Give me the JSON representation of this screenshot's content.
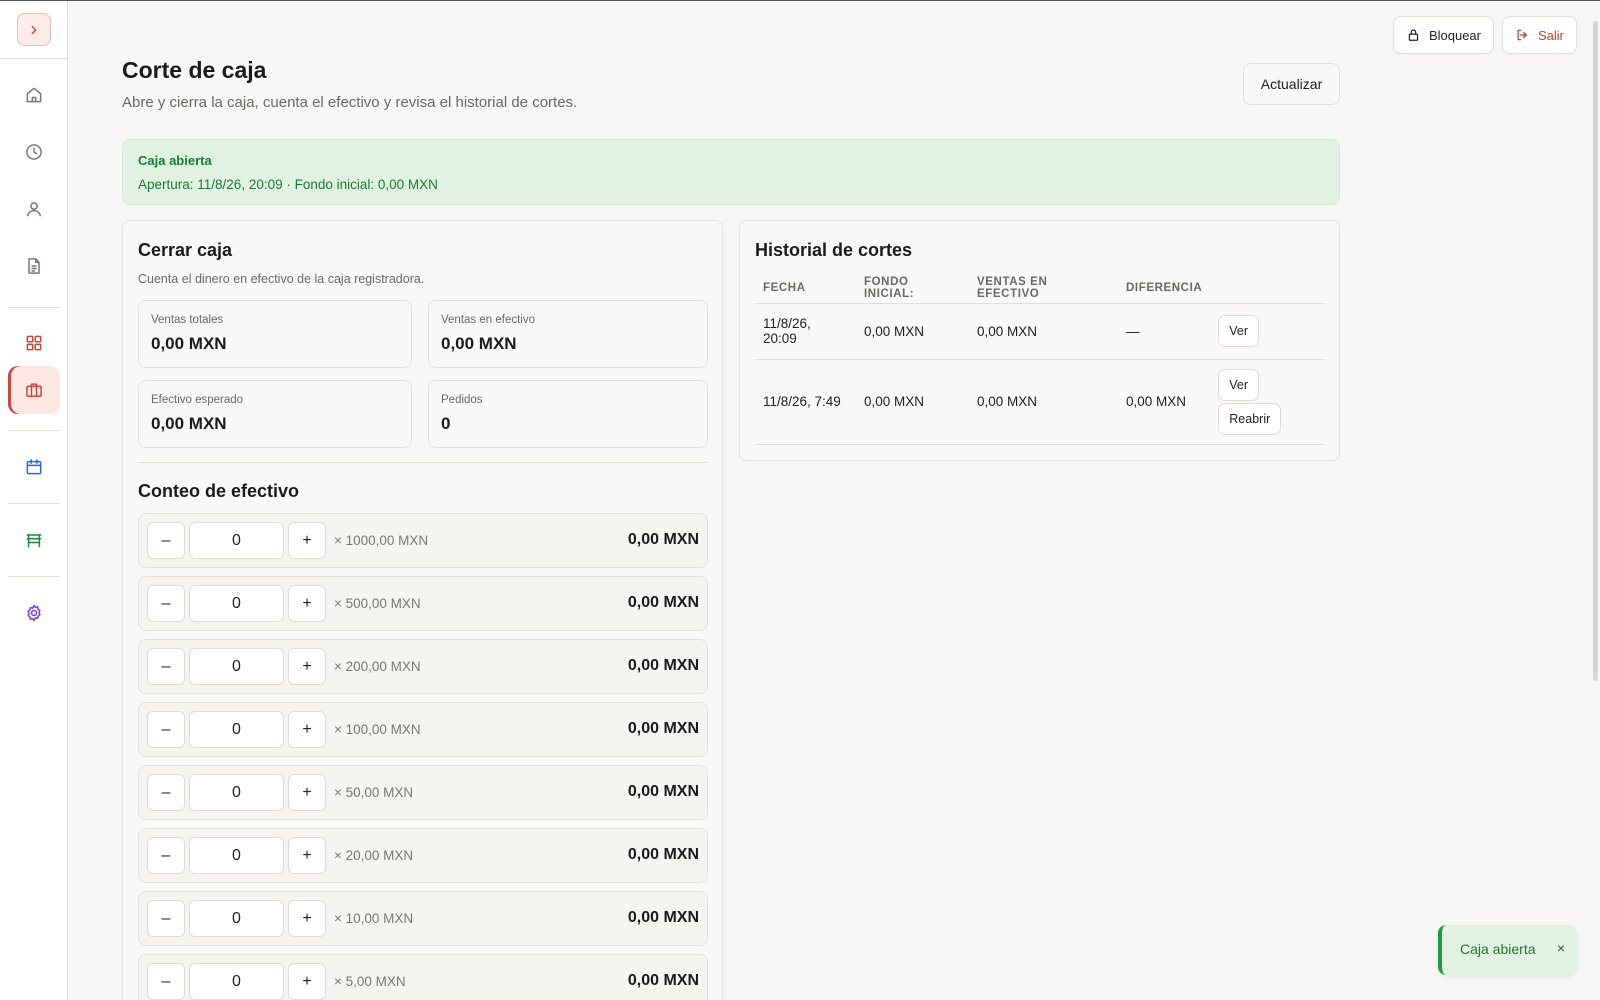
{
  "sidebar": {
    "toggle_icon": "chevron-right-icon",
    "items": [
      {
        "name": "home",
        "icon": "home-icon"
      },
      {
        "name": "history",
        "icon": "clock-icon"
      },
      {
        "name": "user",
        "icon": "user-icon"
      },
      {
        "name": "document",
        "icon": "document-icon"
      },
      {
        "name": "dashboard",
        "icon": "grid-icon"
      },
      {
        "name": "cash-register",
        "icon": "briefcase-icon",
        "active": true
      },
      {
        "name": "calendar",
        "icon": "calendar-icon"
      },
      {
        "name": "tables",
        "icon": "table-icon"
      },
      {
        "name": "settings",
        "icon": "gear-icon"
      }
    ],
    "colors": {
      "accent": "#c9463a",
      "green": "#1f8a3b",
      "blue": "#2563eb",
      "purple": "#7c3aed"
    }
  },
  "topbar": {
    "lock_label": "Bloquear",
    "exit_label": "Salir"
  },
  "header": {
    "title": "Corte de caja",
    "subtitle": "Abre y cierra la caja, cuenta el efectivo y revisa el historial de cortes.",
    "refresh_label": "Actualizar"
  },
  "banner": {
    "title": "Caja abierta",
    "detail": "Apertura: 11/8/26, 20:09 · Fondo inicial: 0,00 MXN"
  },
  "close_panel": {
    "title": "Cerrar caja",
    "description": "Cuenta el dinero en efectivo de la caja registradora.",
    "stats": [
      {
        "label": "Ventas totales",
        "value": "0,00 MXN"
      },
      {
        "label": "Ventas en efectivo",
        "value": "0,00 MXN"
      },
      {
        "label": "Efectivo esperado",
        "value": "0,00 MXN"
      },
      {
        "label": "Pedidos",
        "value": "0"
      }
    ],
    "count_title": "Conteo de efectivo",
    "minus_label": "–",
    "plus_label": "+",
    "denominations": [
      {
        "label": "× 1000,00 MXN",
        "qty": "0",
        "total": "0,00 MXN"
      },
      {
        "label": "× 500,00 MXN",
        "qty": "0",
        "total": "0,00 MXN"
      },
      {
        "label": "× 200,00 MXN",
        "qty": "0",
        "total": "0,00 MXN"
      },
      {
        "label": "× 100,00 MXN",
        "qty": "0",
        "total": "0,00 MXN"
      },
      {
        "label": "× 50,00 MXN",
        "qty": "0",
        "total": "0,00 MXN"
      },
      {
        "label": "× 20,00 MXN",
        "qty": "0",
        "total": "0,00 MXN"
      },
      {
        "label": "× 10,00 MXN",
        "qty": "0",
        "total": "0,00 MXN"
      },
      {
        "label": "× 5,00 MXN",
        "qty": "0",
        "total": "0,00 MXN"
      }
    ]
  },
  "history": {
    "title": "Historial de cortes",
    "columns": [
      "FECHA",
      "FONDO INICIAL:",
      "VENTAS EN EFECTIVO",
      "DIFERENCIA"
    ],
    "rows": [
      {
        "fecha": "11/8/26, 20:09",
        "fondo": "0,00 MXN",
        "ventas": "0,00 MXN",
        "diferencia": "—",
        "actions": [
          "Ver"
        ]
      },
      {
        "fecha": "11/8/26, 7:49",
        "fondo": "0,00 MXN",
        "ventas": "0,00 MXN",
        "diferencia": "0,00 MXN",
        "actions": [
          "Ver",
          "Reabrir"
        ]
      }
    ]
  },
  "toast": {
    "text": "Caja abierta",
    "close": "×"
  }
}
